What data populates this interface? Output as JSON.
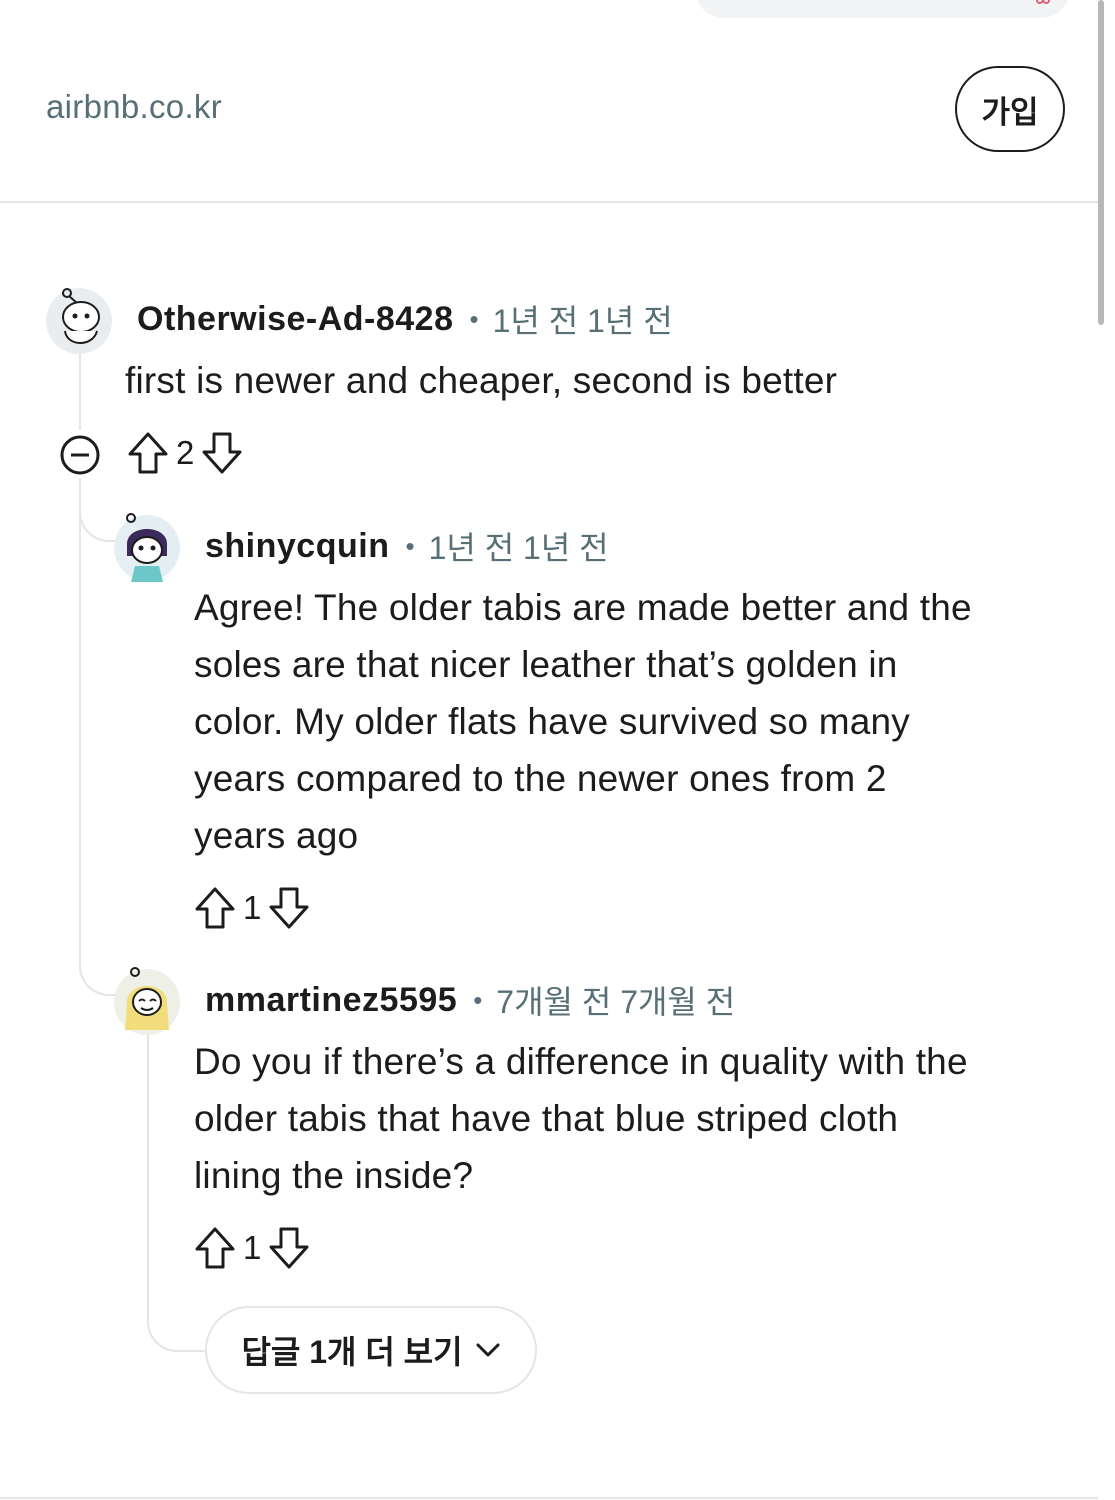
{
  "header": {
    "domain": "airbnb.co.kr",
    "join_label": "가입"
  },
  "comments": [
    {
      "author": "Otherwise-Ad-8428",
      "time": "1년 전 1년 전",
      "body": "first is newer and cheaper, second is better",
      "score": "2"
    },
    {
      "author": "shinycquin",
      "time": "1년 전 1년 전",
      "body": [
        "Agree! The older tabis are made better and the",
        "soles are that nicer leather that’s golden in",
        "color. My older flats have survived so many",
        "years compared to the newer ones from 2",
        "years ago"
      ],
      "score": "1"
    },
    {
      "author": "mmartinez5595",
      "time": "7개월 전 7개월 전",
      "body": [
        "Do you if there’s a difference in quality with the",
        "older tabis that have that blue striped cloth",
        "lining the inside?"
      ],
      "score": "1"
    }
  ],
  "more_replies_label": "답글 1개 더 보기",
  "colors": {
    "text": "#1c1c1c",
    "meta": "#576f76",
    "line": "#e2e6e8"
  },
  "icons": [
    "upvote-icon",
    "downvote-icon",
    "collapse-icon",
    "chevron-down-icon"
  ]
}
